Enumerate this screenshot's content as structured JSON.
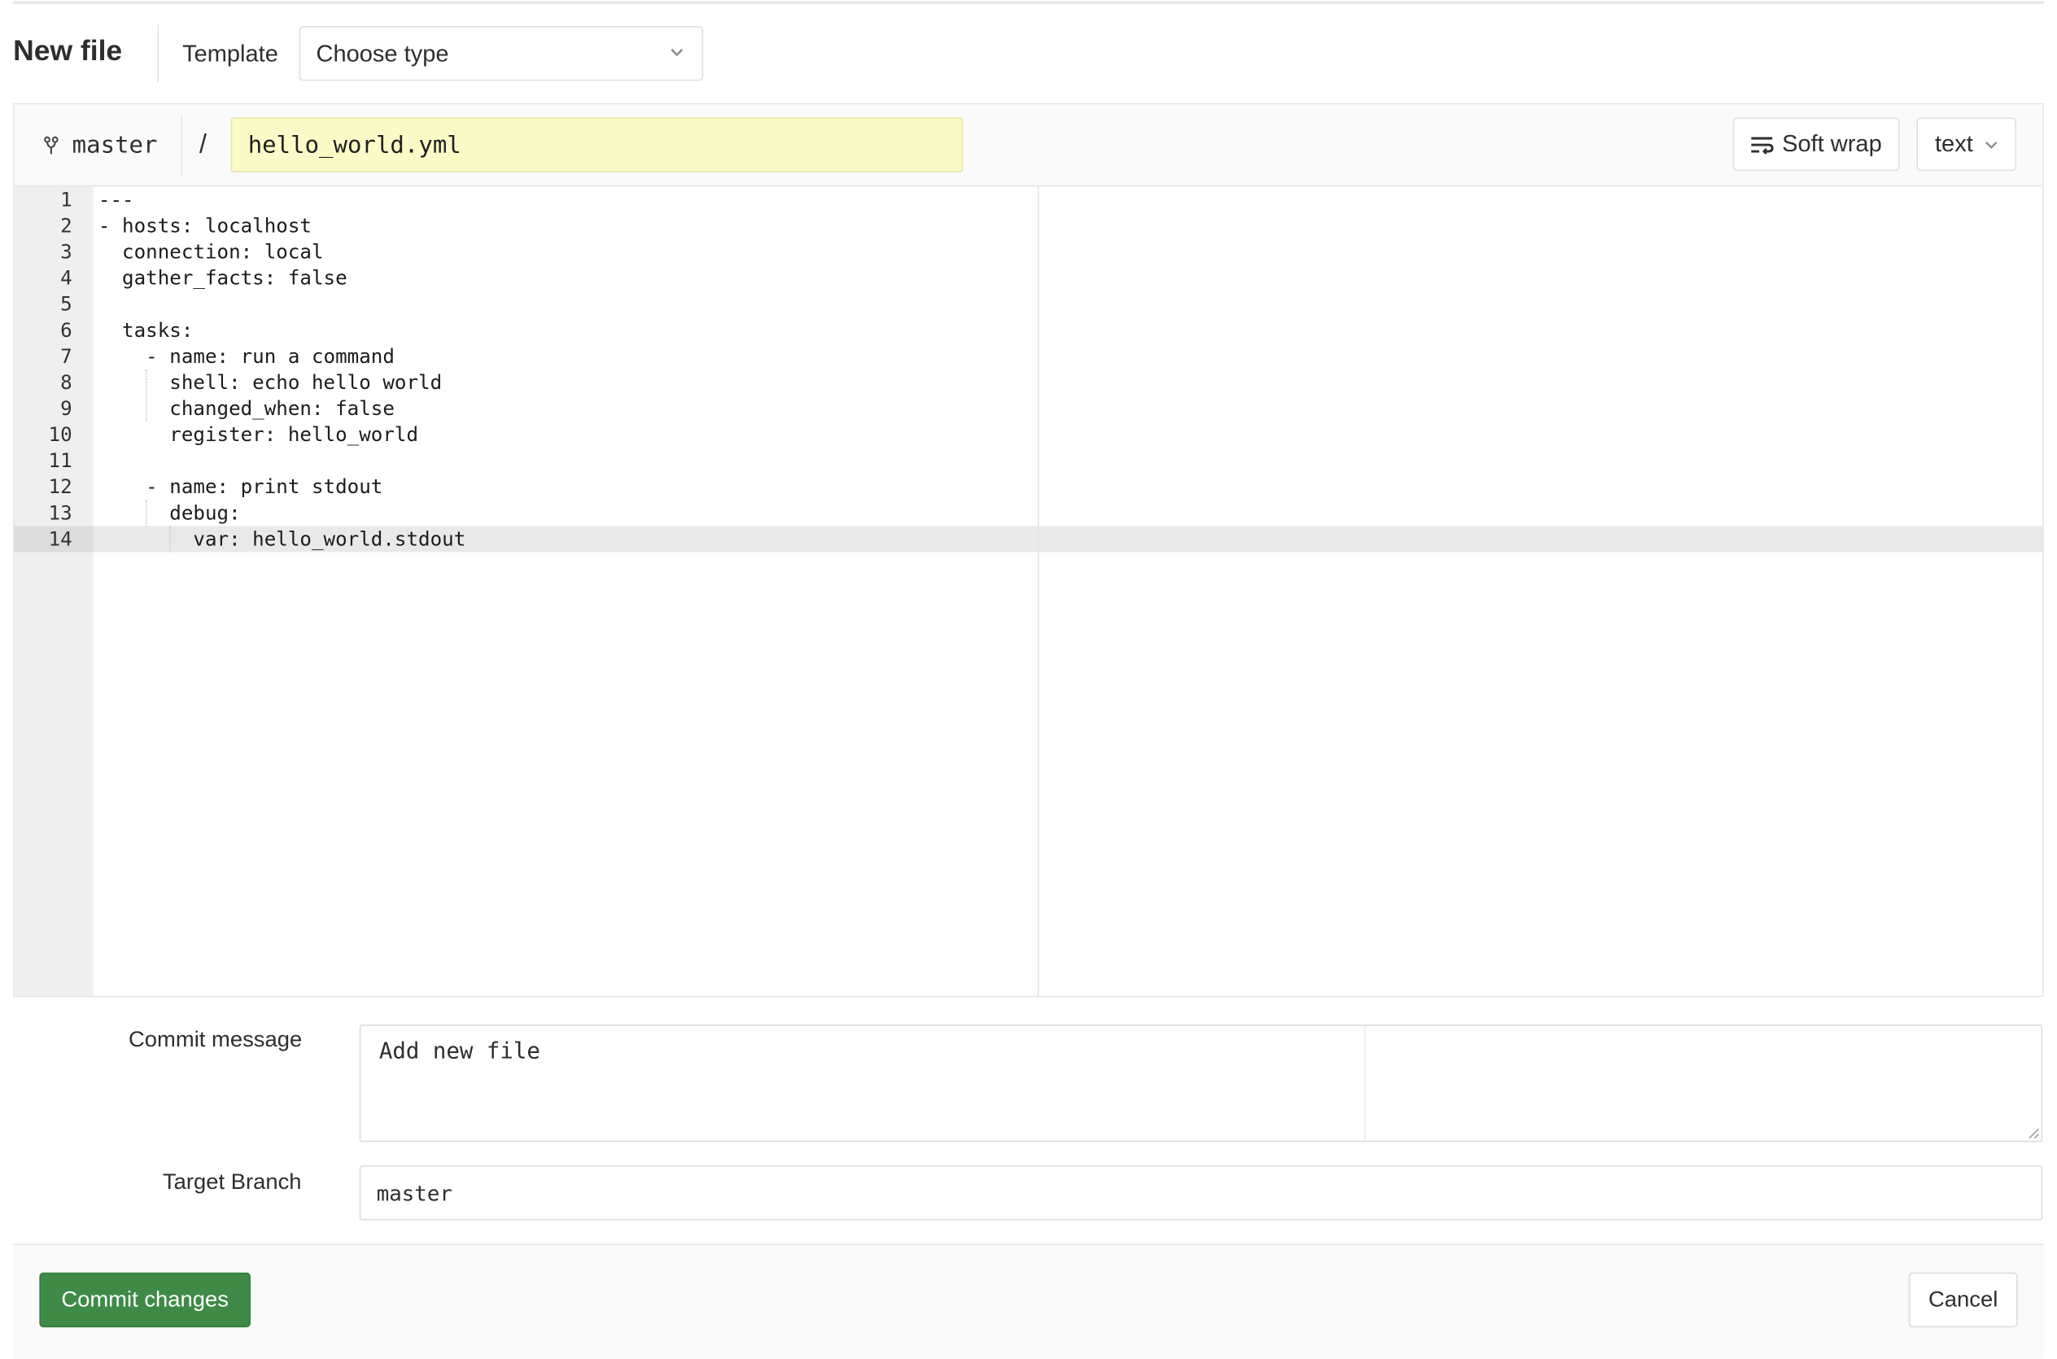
{
  "header": {
    "title": "New file",
    "template_label": "Template",
    "template_select": {
      "value": "Choose type",
      "icon": "chevron-down-icon"
    }
  },
  "editor": {
    "branch": {
      "icon": "branch-icon",
      "name": "master"
    },
    "path_separator": "/",
    "file_name": "hello_world.yml",
    "soft_wrap": {
      "icon": "soft-wrap-icon",
      "label": "Soft wrap"
    },
    "mode": {
      "label": "text",
      "icon": "chevron-down-icon"
    },
    "active_line": 14,
    "lines": [
      {
        "number": "1",
        "text": "---"
      },
      {
        "number": "2",
        "text": "- hosts: localhost"
      },
      {
        "number": "3",
        "text": "  connection: local"
      },
      {
        "number": "4",
        "text": "  gather_facts: false"
      },
      {
        "number": "5",
        "text": ""
      },
      {
        "number": "6",
        "text": "  tasks:"
      },
      {
        "number": "7",
        "text": "    - name: run a command"
      },
      {
        "number": "8",
        "text": "      shell: echo hello world"
      },
      {
        "number": "9",
        "text": "      changed_when: false"
      },
      {
        "number": "10",
        "text": "      register: hello_world"
      },
      {
        "number": "11",
        "text": ""
      },
      {
        "number": "12",
        "text": "    - name: print stdout"
      },
      {
        "number": "13",
        "text": "      debug:"
      },
      {
        "number": "14",
        "text": "        var: hello_world.stdout"
      }
    ]
  },
  "commit": {
    "message_label": "Commit message",
    "message_value": "Add new file",
    "target_label": "Target Branch",
    "target_value": "master"
  },
  "footer": {
    "commit_button": "Commit changes",
    "cancel_button": "Cancel"
  },
  "colors": {
    "commit_green": "#3f8a47",
    "filename_highlight": "#fbfbc8",
    "gutter": "#efefef"
  }
}
